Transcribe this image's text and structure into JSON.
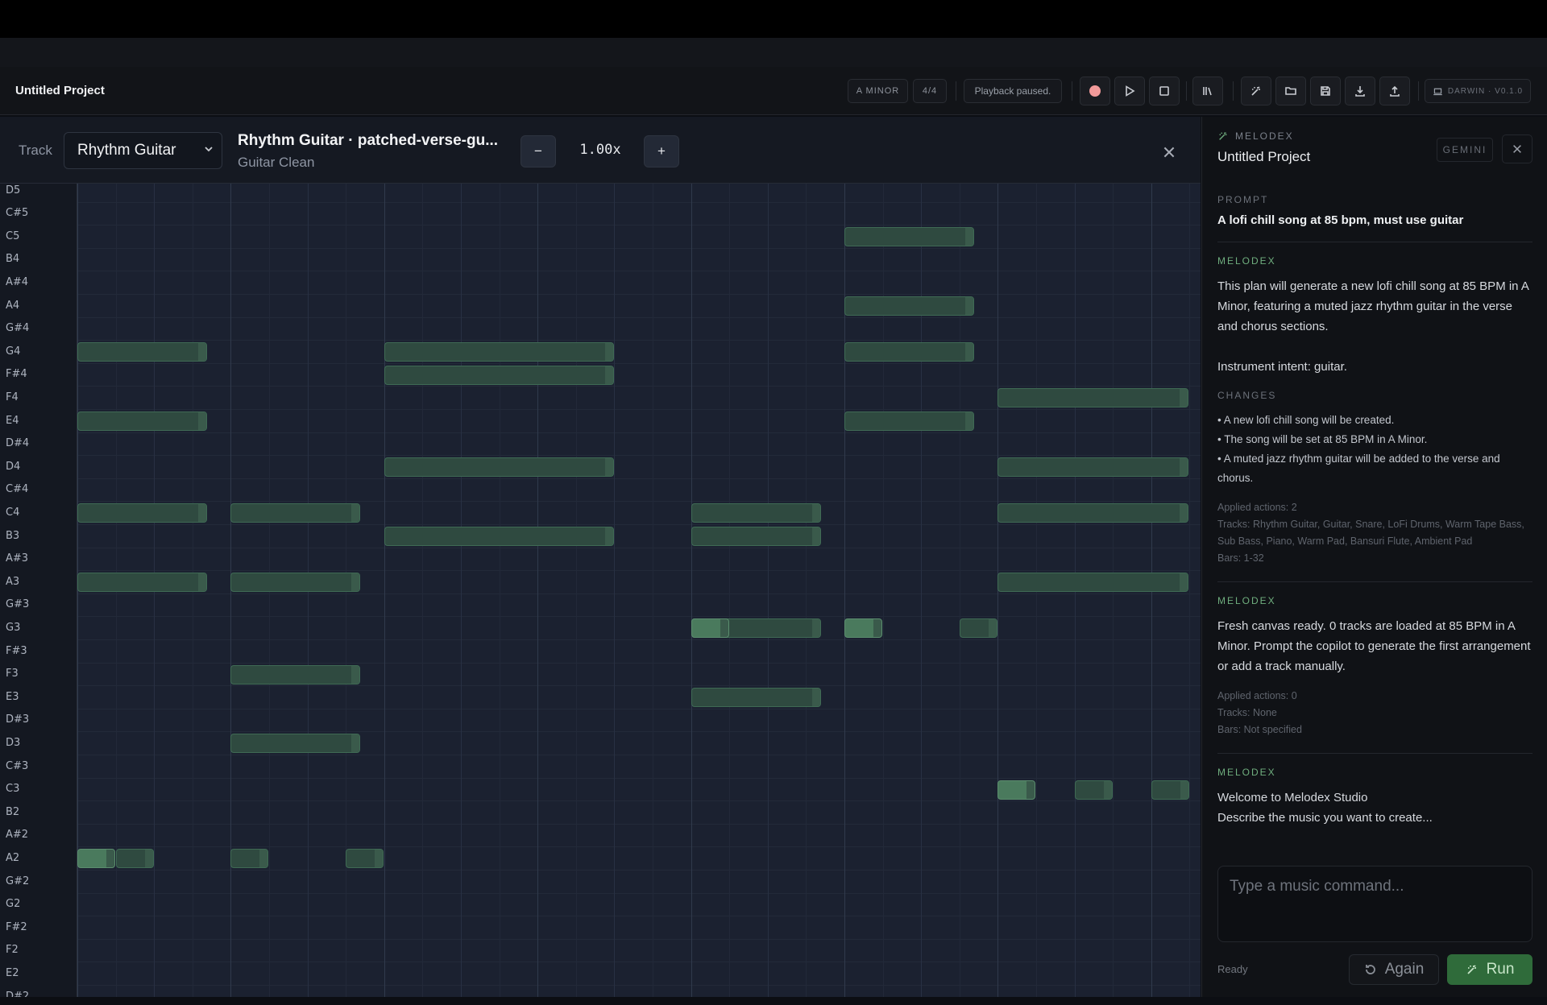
{
  "header": {
    "project_title": "Untitled Project",
    "key": "A MINOR",
    "time_signature": "4/4",
    "playback_status": "Playback paused.",
    "version": "DARWIN · V0.1.0"
  },
  "editor": {
    "track_label": "Track",
    "track_selected": "Rhythm Guitar",
    "clip_title": "Rhythm Guitar · patched-verse-gu...",
    "instrument": "Guitar Clean",
    "zoom_out": "−",
    "zoom_value": "1.00x",
    "zoom_in": "+"
  },
  "piano_keys": [
    "D5",
    "C#5",
    "C5",
    "B4",
    "A#4",
    "A4",
    "G#4",
    "G4",
    "F#4",
    "F4",
    "E4",
    "D#4",
    "D4",
    "C#4",
    "C4",
    "B3",
    "A#3",
    "A3",
    "G#3",
    "G3",
    "F#3",
    "F3",
    "E3",
    "D#3",
    "D3",
    "C#3",
    "C3",
    "B2",
    "A#2",
    "A2",
    "G#2",
    "G2",
    "F#2",
    "F2",
    "E2",
    "D#2"
  ],
  "notes": [
    {
      "pitch": "G4",
      "start": 0,
      "dur": 3.4
    },
    {
      "pitch": "E4",
      "start": 0,
      "dur": 3.4
    },
    {
      "pitch": "C4",
      "start": 0,
      "dur": 3.4
    },
    {
      "pitch": "A3",
      "start": 0,
      "dur": 3.4
    },
    {
      "pitch": "A2",
      "start": 0,
      "dur": 1,
      "hot": true
    },
    {
      "pitch": "A2",
      "start": 1,
      "dur": 1
    },
    {
      "pitch": "C4",
      "start": 4,
      "dur": 3.4
    },
    {
      "pitch": "A3",
      "start": 4,
      "dur": 3.4
    },
    {
      "pitch": "F3",
      "start": 4,
      "dur": 3.4
    },
    {
      "pitch": "D3",
      "start": 4,
      "dur": 3.4
    },
    {
      "pitch": "A2",
      "start": 4,
      "dur": 1
    },
    {
      "pitch": "A2",
      "start": 7,
      "dur": 1
    },
    {
      "pitch": "G4",
      "start": 8,
      "dur": 6
    },
    {
      "pitch": "F#4",
      "start": 8,
      "dur": 6
    },
    {
      "pitch": "D4",
      "start": 8,
      "dur": 6
    },
    {
      "pitch": "B3",
      "start": 8,
      "dur": 6
    },
    {
      "pitch": "C4",
      "start": 16,
      "dur": 3.4
    },
    {
      "pitch": "B3",
      "start": 16,
      "dur": 3.4
    },
    {
      "pitch": "G3",
      "start": 16,
      "dur": 3.4
    },
    {
      "pitch": "E3",
      "start": 16,
      "dur": 3.4
    },
    {
      "pitch": "G3",
      "start": 16,
      "dur": 1,
      "hot": true
    },
    {
      "pitch": "C5",
      "start": 20,
      "dur": 3.4
    },
    {
      "pitch": "A4",
      "start": 20,
      "dur": 3.4
    },
    {
      "pitch": "G4",
      "start": 20,
      "dur": 3.4
    },
    {
      "pitch": "E4",
      "start": 20,
      "dur": 3.4
    },
    {
      "pitch": "G3",
      "start": 20,
      "dur": 1,
      "hot": true
    },
    {
      "pitch": "G3",
      "start": 23,
      "dur": 1
    },
    {
      "pitch": "F4",
      "start": 24,
      "dur": 5
    },
    {
      "pitch": "D4",
      "start": 24,
      "dur": 5
    },
    {
      "pitch": "C4",
      "start": 24,
      "dur": 5
    },
    {
      "pitch": "A3",
      "start": 24,
      "dur": 5
    },
    {
      "pitch": "C3",
      "start": 24,
      "dur": 1,
      "hot": true
    },
    {
      "pitch": "C3",
      "start": 26,
      "dur": 1
    },
    {
      "pitch": "C3",
      "start": 28,
      "dur": 1
    }
  ],
  "side": {
    "brand": "MELODEX",
    "title": "Untitled Project",
    "model": "GEMINI",
    "prompt_label": "PROMPT",
    "prompt": "A lofi chill song at 85 bpm, must use guitar",
    "messages": [
      {
        "author": "MELODEX",
        "body": [
          "This plan will generate a new lofi chill song at 85 BPM in A Minor, featuring a muted jazz rhythm guitar in the verse and chorus sections.",
          "Instrument intent: guitar."
        ],
        "changes_label": "CHANGES",
        "changes": [
          "• A new lofi chill song will be created.",
          "• The song will be set at 85 BPM in A Minor.",
          "• A muted jazz rhythm guitar will be added to the verse and chorus."
        ],
        "meta": [
          "Applied actions: 2",
          "Tracks: Rhythm Guitar, Guitar, Snare, LoFi Drums, Warm Tape Bass, Sub Bass, Piano, Warm Pad, Bansuri Flute, Ambient Pad",
          "Bars: 1-32"
        ]
      },
      {
        "author": "MELODEX",
        "body": [
          "Fresh canvas ready. 0 tracks are loaded at 85 BPM in A Minor. Prompt the copilot to generate the first arrangement or add a track manually."
        ],
        "meta": [
          "Applied actions: 0",
          "Tracks: None",
          "Bars: Not specified"
        ]
      },
      {
        "author": "MELODEX",
        "body": [
          "Welcome to Melodex Studio",
          "Describe the music you want to create..."
        ]
      }
    ],
    "command_placeholder": "Type a music command...",
    "status": "Ready",
    "again_label": "Again",
    "run_label": "Run"
  }
}
